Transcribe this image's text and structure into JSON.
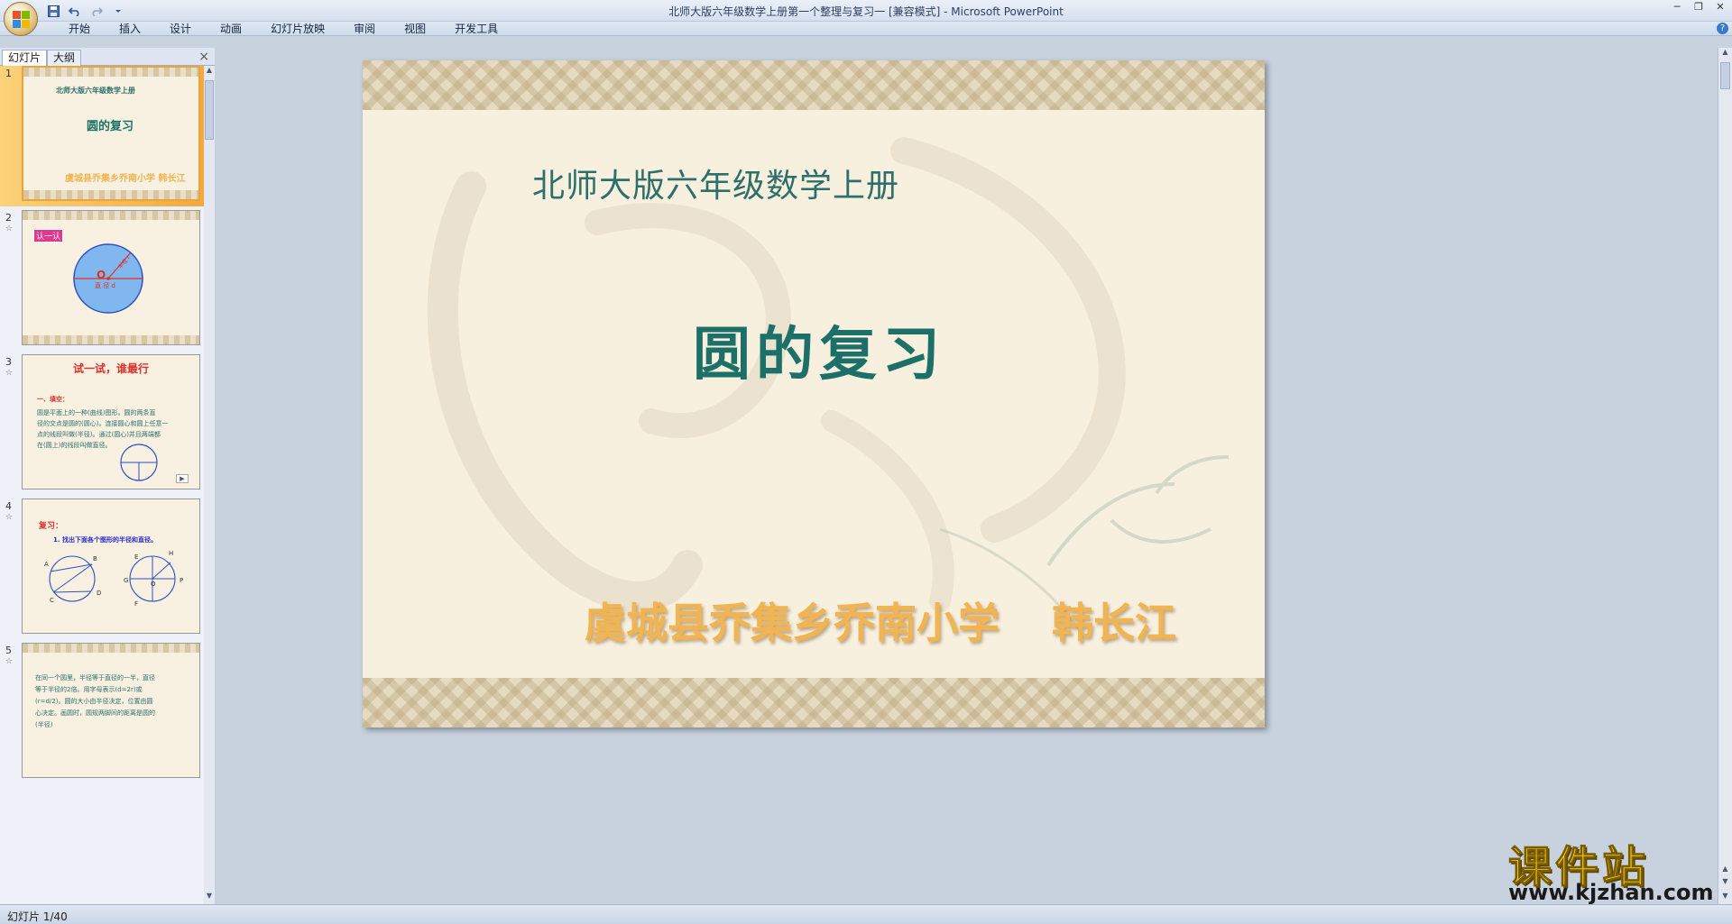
{
  "window": {
    "title": "北师大版六年级数学上册第一个整理与复习一 [兼容模式] - Microsoft PowerPoint"
  },
  "qat": {
    "save_icon": "save-icon",
    "undo_icon": "undo-icon",
    "redo_icon": "redo-icon"
  },
  "ribbon": {
    "tabs": [
      "开始",
      "插入",
      "设计",
      "动画",
      "幻灯片放映",
      "审阅",
      "视图",
      "开发工具"
    ]
  },
  "panel": {
    "tabs": [
      "幻灯片",
      "大纲"
    ],
    "close": "×"
  },
  "thumbnails": [
    {
      "num": "1",
      "subtitle": "北师大版六年级数学上册",
      "title": "圆的复习",
      "author": "虞城县乔集乡乔南小学 韩长江"
    },
    {
      "num": "2",
      "label": "认一认",
      "center": "O",
      "radius_label": "半径 r",
      "diameter_label": "直 径 d"
    },
    {
      "num": "3",
      "heading": "试一试，谁最行",
      "section": "一、填空：",
      "line1": "圆是平面上的一种(曲线)图形。圆的两条直",
      "line2": "径的交点是圆的(圆心)。连接圆心和圆上任意一",
      "line3": "点的线段叫做(半径)。通过(圆心)并且两端都",
      "line4": "在(圆上)的线段叫做直径。"
    },
    {
      "num": "4",
      "heading": "复习：",
      "question": "1. 找出下面各个图形的半径和直径。",
      "pts_a": [
        "A",
        "B",
        "C",
        "D"
      ],
      "pts_b": [
        "E",
        "H",
        "G",
        "O",
        "P",
        "F"
      ]
    },
    {
      "num": "5",
      "line1": "在同一个圆里，半径等于直径的一半，直径",
      "line2": "等于半径的2倍。用字母表示(d=2r)或",
      "line3": "(r=d/2)。圆的大小由半径决定，位置由圆",
      "line4": "心决定。画圆时，圆规两脚间的距离是圆的",
      "line5": "(半径)"
    }
  ],
  "slide": {
    "subtitle": "北师大版六年级数学上册",
    "title": "圆的复习",
    "author_school": "虞城县乔集乡乔南小学",
    "author_name": "韩长江"
  },
  "watermark": {
    "main": "课件站",
    "url": "www.kjzhan.com"
  },
  "status": {
    "text": "幻灯片 1/40"
  },
  "colors": {
    "title_teal": "#1c7068",
    "author_orange": "#f2b451",
    "selected_thumb": "#f5a93c"
  }
}
